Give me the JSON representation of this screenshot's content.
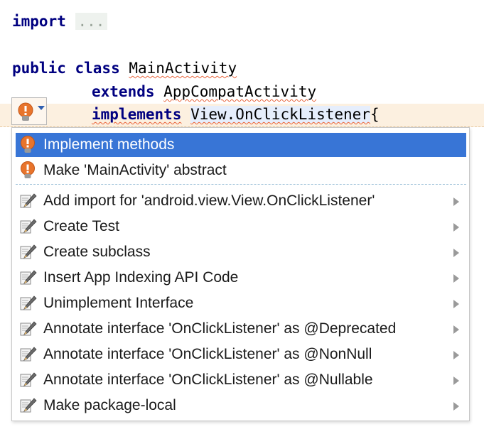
{
  "editor": {
    "lines": [
      {
        "kw": "import",
        "folded": "..."
      },
      {
        "kw": "public class",
        "name": "MainActivity"
      },
      {
        "kw": "extends",
        "name": "AppCompatActivity"
      },
      {
        "kw": "implements",
        "name": "View.OnClickListener",
        "brace": "{"
      }
    ]
  },
  "popup": {
    "quick_fixes": [
      {
        "label": "Implement methods",
        "icon": "lightbulb-icon",
        "selected": true
      },
      {
        "label": "Make 'MainActivity' abstract",
        "icon": "lightbulb-icon"
      }
    ],
    "intentions": [
      {
        "label": "Add import for 'android.view.View.OnClickListener'",
        "icon": "pencil-icon"
      },
      {
        "label": "Create Test",
        "icon": "pencil-icon"
      },
      {
        "label": "Create subclass",
        "icon": "pencil-icon"
      },
      {
        "label": "Insert App Indexing API Code",
        "icon": "pencil-icon"
      },
      {
        "label": "Unimplement Interface",
        "icon": "pencil-icon"
      },
      {
        "label": "Annotate interface 'OnClickListener' as @Deprecated",
        "icon": "pencil-icon"
      },
      {
        "label": "Annotate interface 'OnClickListener' as @NonNull",
        "icon": "pencil-icon"
      },
      {
        "label": "Annotate interface 'OnClickListener' as @Nullable",
        "icon": "pencil-icon"
      },
      {
        "label": "Make package-local",
        "icon": "pencil-icon"
      }
    ]
  },
  "colors": {
    "keyword": "#000080",
    "selection": "#3875d6",
    "line_highlight": "#fcf0e0",
    "bulb": "#e8742c"
  }
}
